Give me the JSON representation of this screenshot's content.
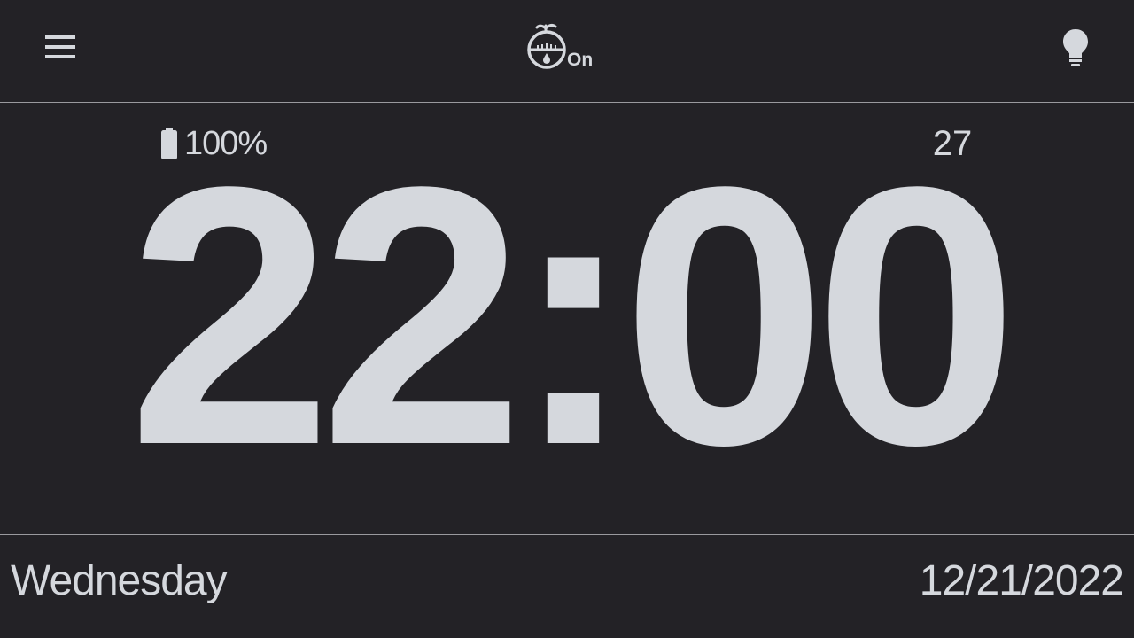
{
  "header": {
    "menu_icon": "hamburger-menu-icon",
    "timer_icon": "tomato-timer-icon",
    "timer_state": "On",
    "light_icon": "lightbulb-icon"
  },
  "status": {
    "battery_icon": "battery-icon",
    "battery_level": "100%",
    "seconds": "27"
  },
  "clock": {
    "time": "22:00"
  },
  "footer": {
    "weekday": "Wednesday",
    "date": "12/21/2022"
  },
  "colors": {
    "background": "#232226",
    "foreground": "#d5d8dd",
    "divider": "#9a9a9e"
  }
}
